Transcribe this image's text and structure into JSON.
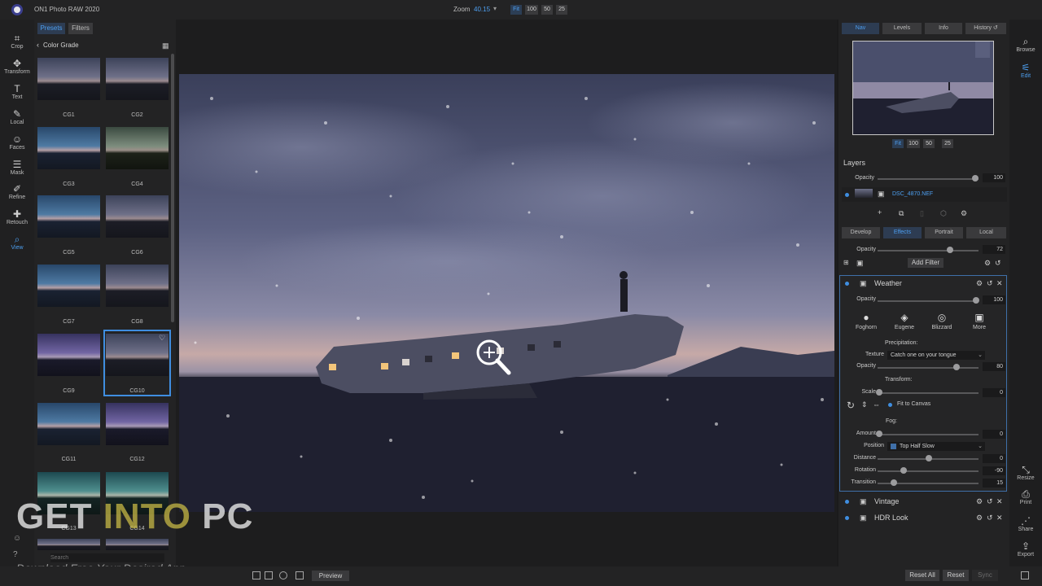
{
  "app": {
    "title": "ON1 Photo RAW 2020"
  },
  "zoom": {
    "label": "Zoom",
    "value": "40.15",
    "caret": "▾",
    "buttons": [
      "Fit",
      "100",
      "50",
      "25"
    ]
  },
  "tools": [
    {
      "label": "Crop",
      "icon": "crop-icon",
      "glyph": "⌗"
    },
    {
      "label": "Transform",
      "icon": "transform-icon",
      "glyph": "✥"
    },
    {
      "label": "Text",
      "icon": "text-icon",
      "glyph": "T"
    },
    {
      "label": "Local",
      "icon": "local-brush-icon",
      "glyph": "✎"
    },
    {
      "label": "Faces",
      "icon": "faces-icon",
      "glyph": "☺"
    },
    {
      "label": "Mask",
      "icon": "mask-icon",
      "glyph": "☰"
    },
    {
      "label": "Refine",
      "icon": "refine-icon",
      "glyph": "✐"
    },
    {
      "label": "Retouch",
      "icon": "retouch-icon",
      "glyph": "✚"
    },
    {
      "label": "View",
      "icon": "view-zoom-icon",
      "glyph": "⌕"
    }
  ],
  "presets_panel": {
    "tabs": [
      "Presets",
      "Filters"
    ],
    "category": "Color Grade",
    "back": "‹",
    "grid_glyph": "▦",
    "heart_glyph": "♡",
    "search_placeholder": "Search",
    "items": [
      "CG1",
      "CG2",
      "CG3",
      "CG4",
      "CG5",
      "CG6",
      "CG7",
      "CG8",
      "CG9",
      "CG10",
      "CG11",
      "CG12",
      "CG13",
      "CG14"
    ],
    "selected": "CG10"
  },
  "watermark": {
    "get": "GET ",
    "into": "INTO",
    "pc": " PC",
    "subtitle": "Download Free Your Desired App"
  },
  "bottombar": {
    "preview": "Preview",
    "reset_all": "Reset All",
    "reset": "Reset",
    "sync": "Sync"
  },
  "right_tabs": [
    "Nav",
    "Levels",
    "Info",
    "History ↺"
  ],
  "nav_buttons": [
    "Fit",
    "100",
    "50",
    "25"
  ],
  "layers": {
    "heading": "Layers",
    "opacity_label": "Opacity",
    "opacity_value": "100",
    "layer_name": "DSC_4870.NEF",
    "opacity_fraction": 0.98
  },
  "develop_tabs": [
    "Develop",
    "Effects",
    "Portrait",
    "Local"
  ],
  "effects": {
    "opacity_label": "Opacity",
    "opacity_value": "72",
    "add_filter": "Add Filter"
  },
  "weather": {
    "title": "Weather",
    "opacity_label": "Opacity",
    "opacity_value": "100",
    "styles": [
      {
        "label": "Foghorn",
        "glyph": "●"
      },
      {
        "label": "Eugene",
        "glyph": "◈"
      },
      {
        "label": "Blizzard",
        "glyph": "◎"
      },
      {
        "label": "More",
        "glyph": "▣"
      }
    ],
    "precipitation_heading": "Precipitation:",
    "texture_label": "Texture",
    "texture_value": "Catch one on your tongue",
    "precip_opacity_label": "Opacity",
    "precip_opacity_value": "80",
    "transform_heading": "Transform:",
    "scale_label": "Scale",
    "scale_value": "0",
    "fit_canvas": "Fit to Canvas",
    "fog_heading": "Fog:",
    "amount_label": "Amount",
    "amount_value": "0",
    "position_label": "Position",
    "position_value": "Top Half Slow",
    "distance_label": "Distance",
    "distance_value": "0",
    "rotation_label": "Rotation",
    "rotation_value": "-90",
    "transition_label": "Transition",
    "transition_value": "15"
  },
  "other_filters": [
    "Vintage",
    "HDR Look"
  ],
  "far_right": [
    {
      "label": "Browse",
      "icon": "browse-icon",
      "glyph": "⌕"
    },
    {
      "label": "Edit",
      "icon": "edit-icon",
      "glyph": "⚟"
    },
    {
      "label": "Resize",
      "icon": "resize-icon",
      "glyph": "⤡"
    },
    {
      "label": "Print",
      "icon": "print-icon",
      "glyph": "⎙"
    },
    {
      "label": "Share",
      "icon": "share-icon",
      "glyph": "⋰"
    },
    {
      "label": "Export",
      "icon": "export-icon",
      "glyph": "⇪"
    }
  ]
}
